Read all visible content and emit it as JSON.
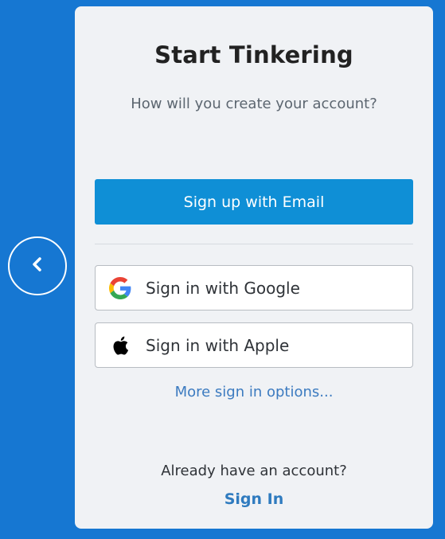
{
  "card": {
    "title": "Start Tinkering",
    "subtitle": "How will you create your account?"
  },
  "buttons": {
    "email_label": "Sign up with Email",
    "google_label": "Sign in with Google",
    "apple_label": "Sign in with Apple"
  },
  "links": {
    "more_options": "More sign in options...",
    "already_text": "Already have an account?",
    "sign_in": "Sign In"
  },
  "icons": {
    "back": "chevron-left-icon",
    "google": "google-icon",
    "apple": "apple-icon"
  },
  "colors": {
    "background": "#1677d2",
    "card": "#f0f2f5",
    "primary_button": "#0f8fd6",
    "link": "#3c7bc0",
    "title_text": "#222222"
  }
}
